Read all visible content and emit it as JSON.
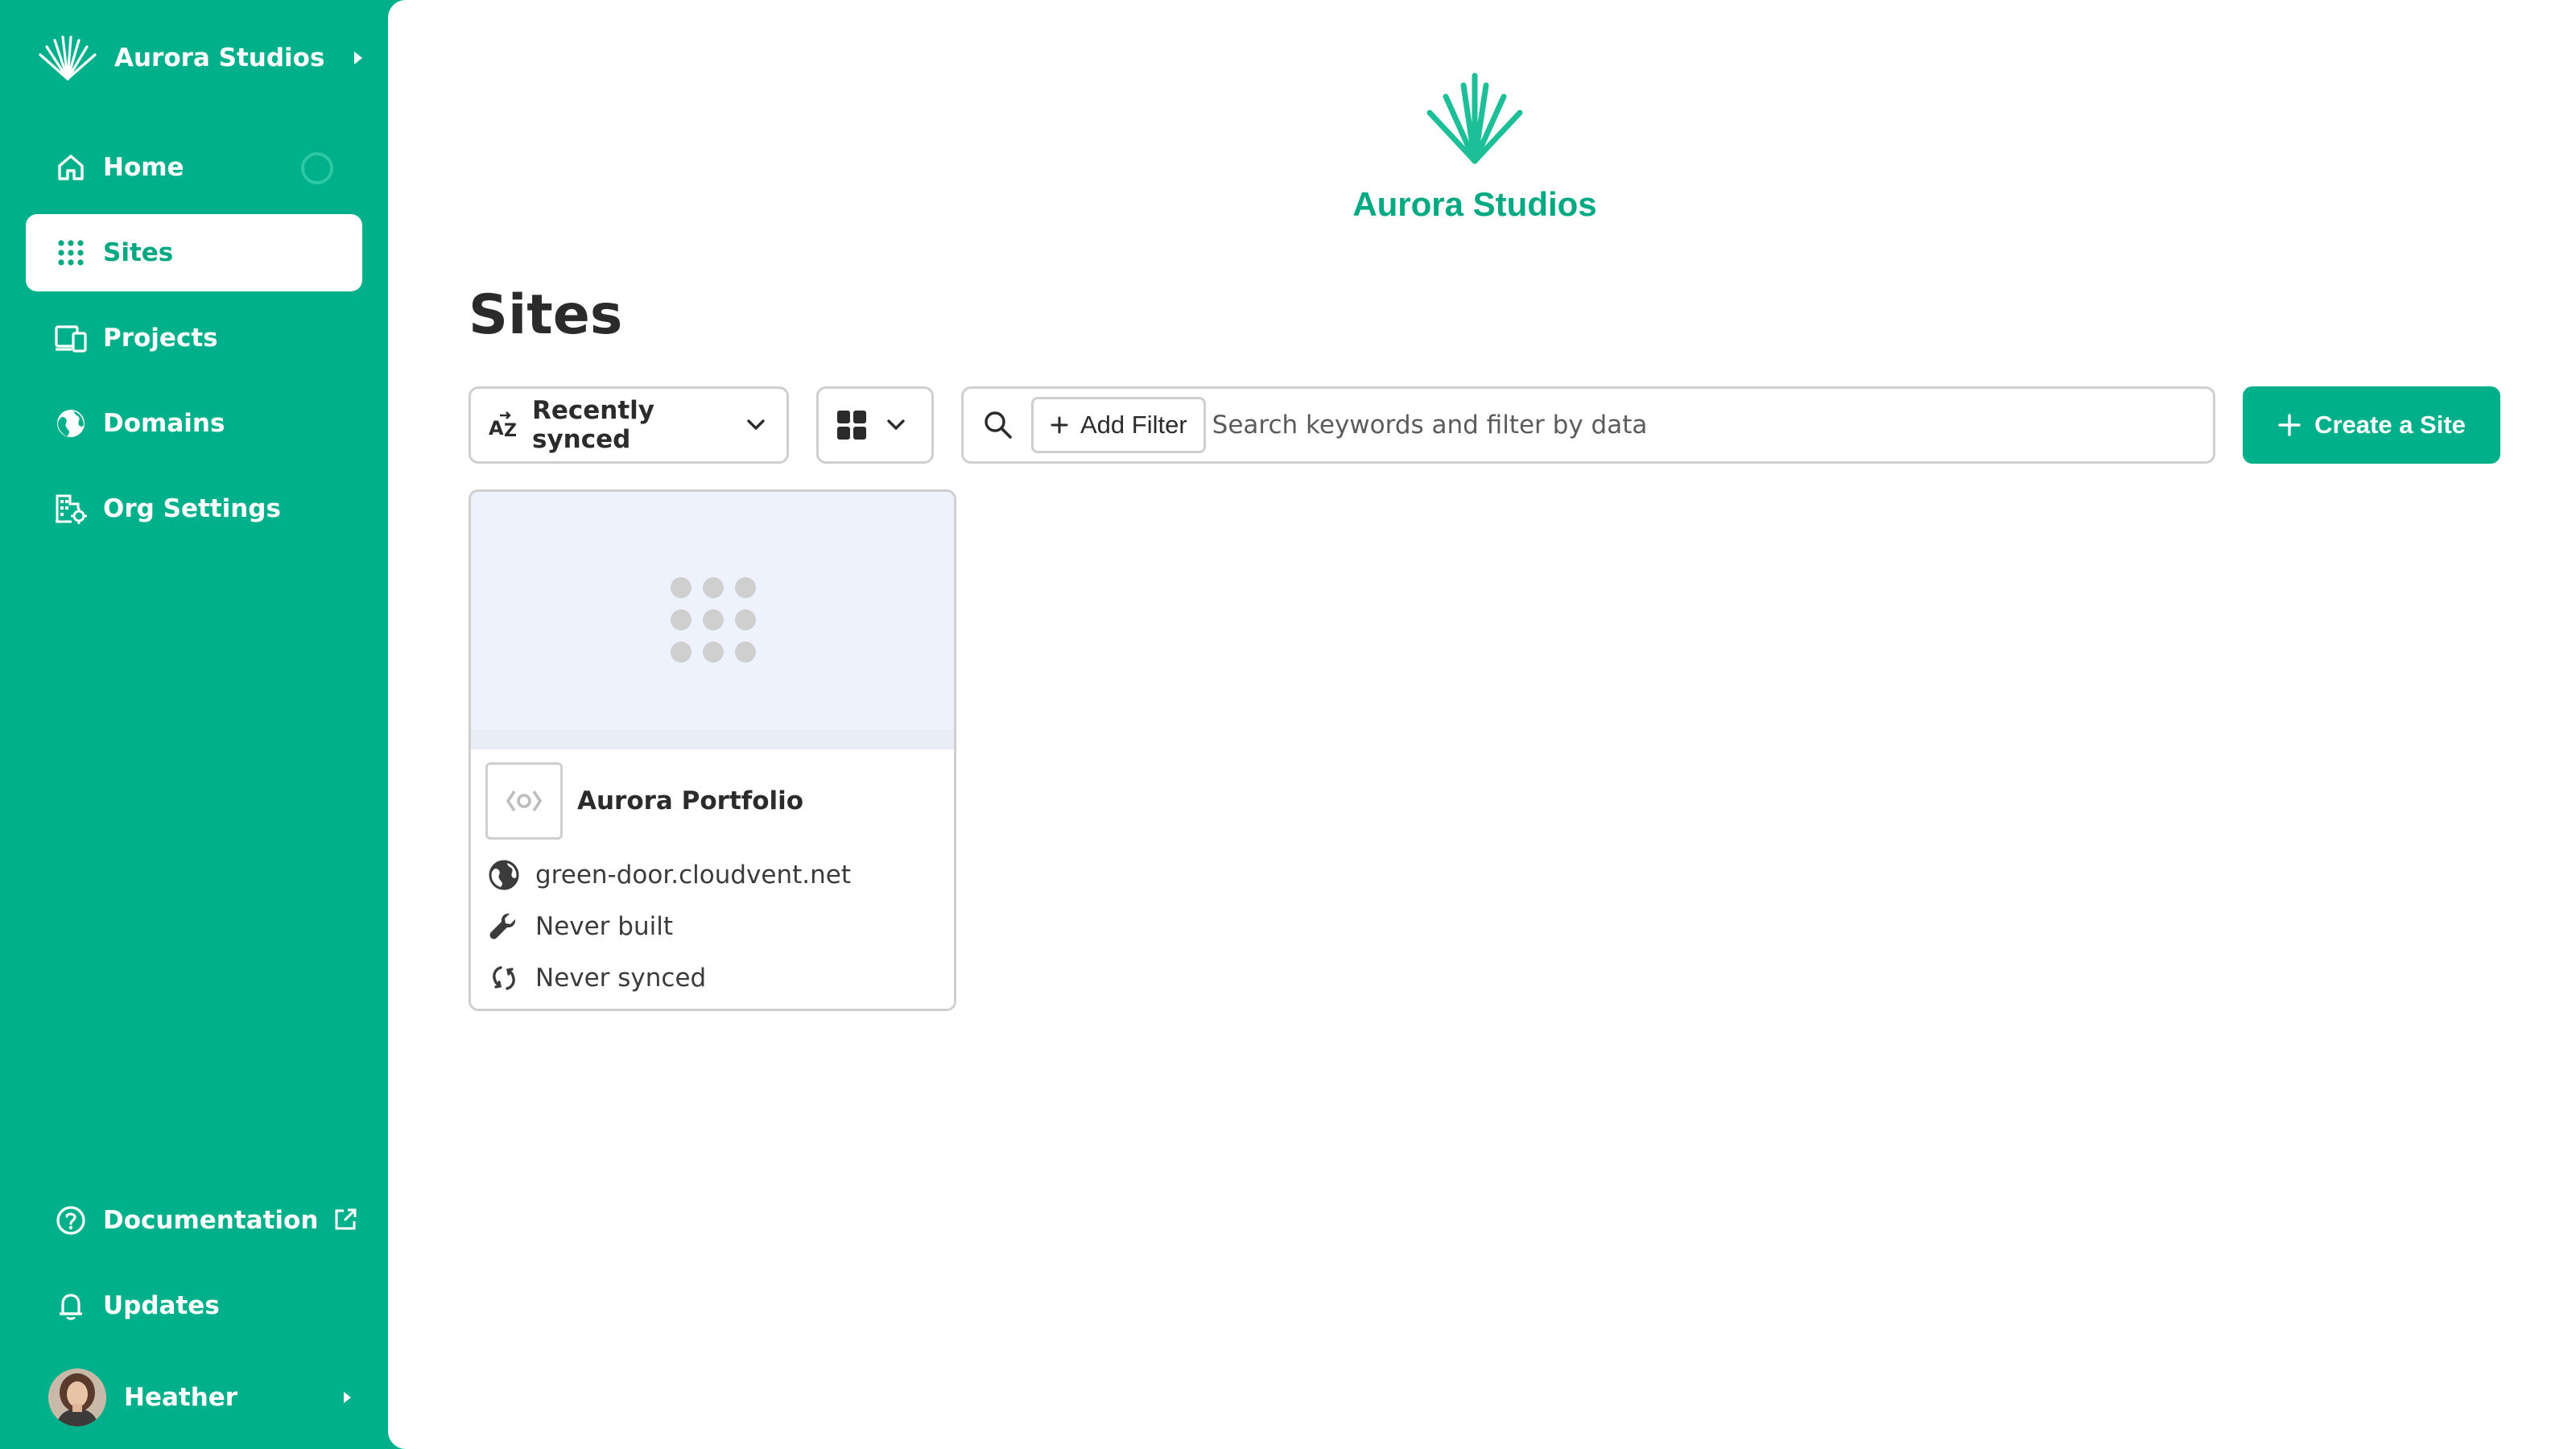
{
  "sidebar": {
    "org_name": "Aurora Studios",
    "items": [
      {
        "label": "Home",
        "icon": "home-icon"
      },
      {
        "label": "Sites",
        "icon": "grid-dots-icon"
      },
      {
        "label": "Projects",
        "icon": "devices-icon"
      },
      {
        "label": "Domains",
        "icon": "globe-icon"
      },
      {
        "label": "Org Settings",
        "icon": "building-gear-icon"
      }
    ],
    "active_item": "Sites",
    "bottom_items": [
      {
        "label": "Documentation",
        "icon": "help-circle-icon",
        "external": true
      },
      {
        "label": "Updates",
        "icon": "bell-icon"
      }
    ],
    "user": {
      "name": "Heather"
    }
  },
  "brand": {
    "name": "Aurora Studios"
  },
  "main": {
    "title": "Sites",
    "sort": {
      "label": "Recently synced",
      "icon": "sort-az-icon"
    },
    "view": {
      "icon": "grid-view-icon"
    },
    "search": {
      "add_filter_label": "Add Filter",
      "placeholder": "Search keywords and filter by data"
    },
    "create_button_label": "Create a Site"
  },
  "sites": [
    {
      "name": "Aurora Portfolio",
      "domain": "green-door.cloudvent.net",
      "build_status": "Never built",
      "sync_status": "Never synced"
    }
  ],
  "colors": {
    "brand": "#00b08a",
    "brand_text": "#00a982",
    "thumb_bg": "#eef2fc"
  }
}
